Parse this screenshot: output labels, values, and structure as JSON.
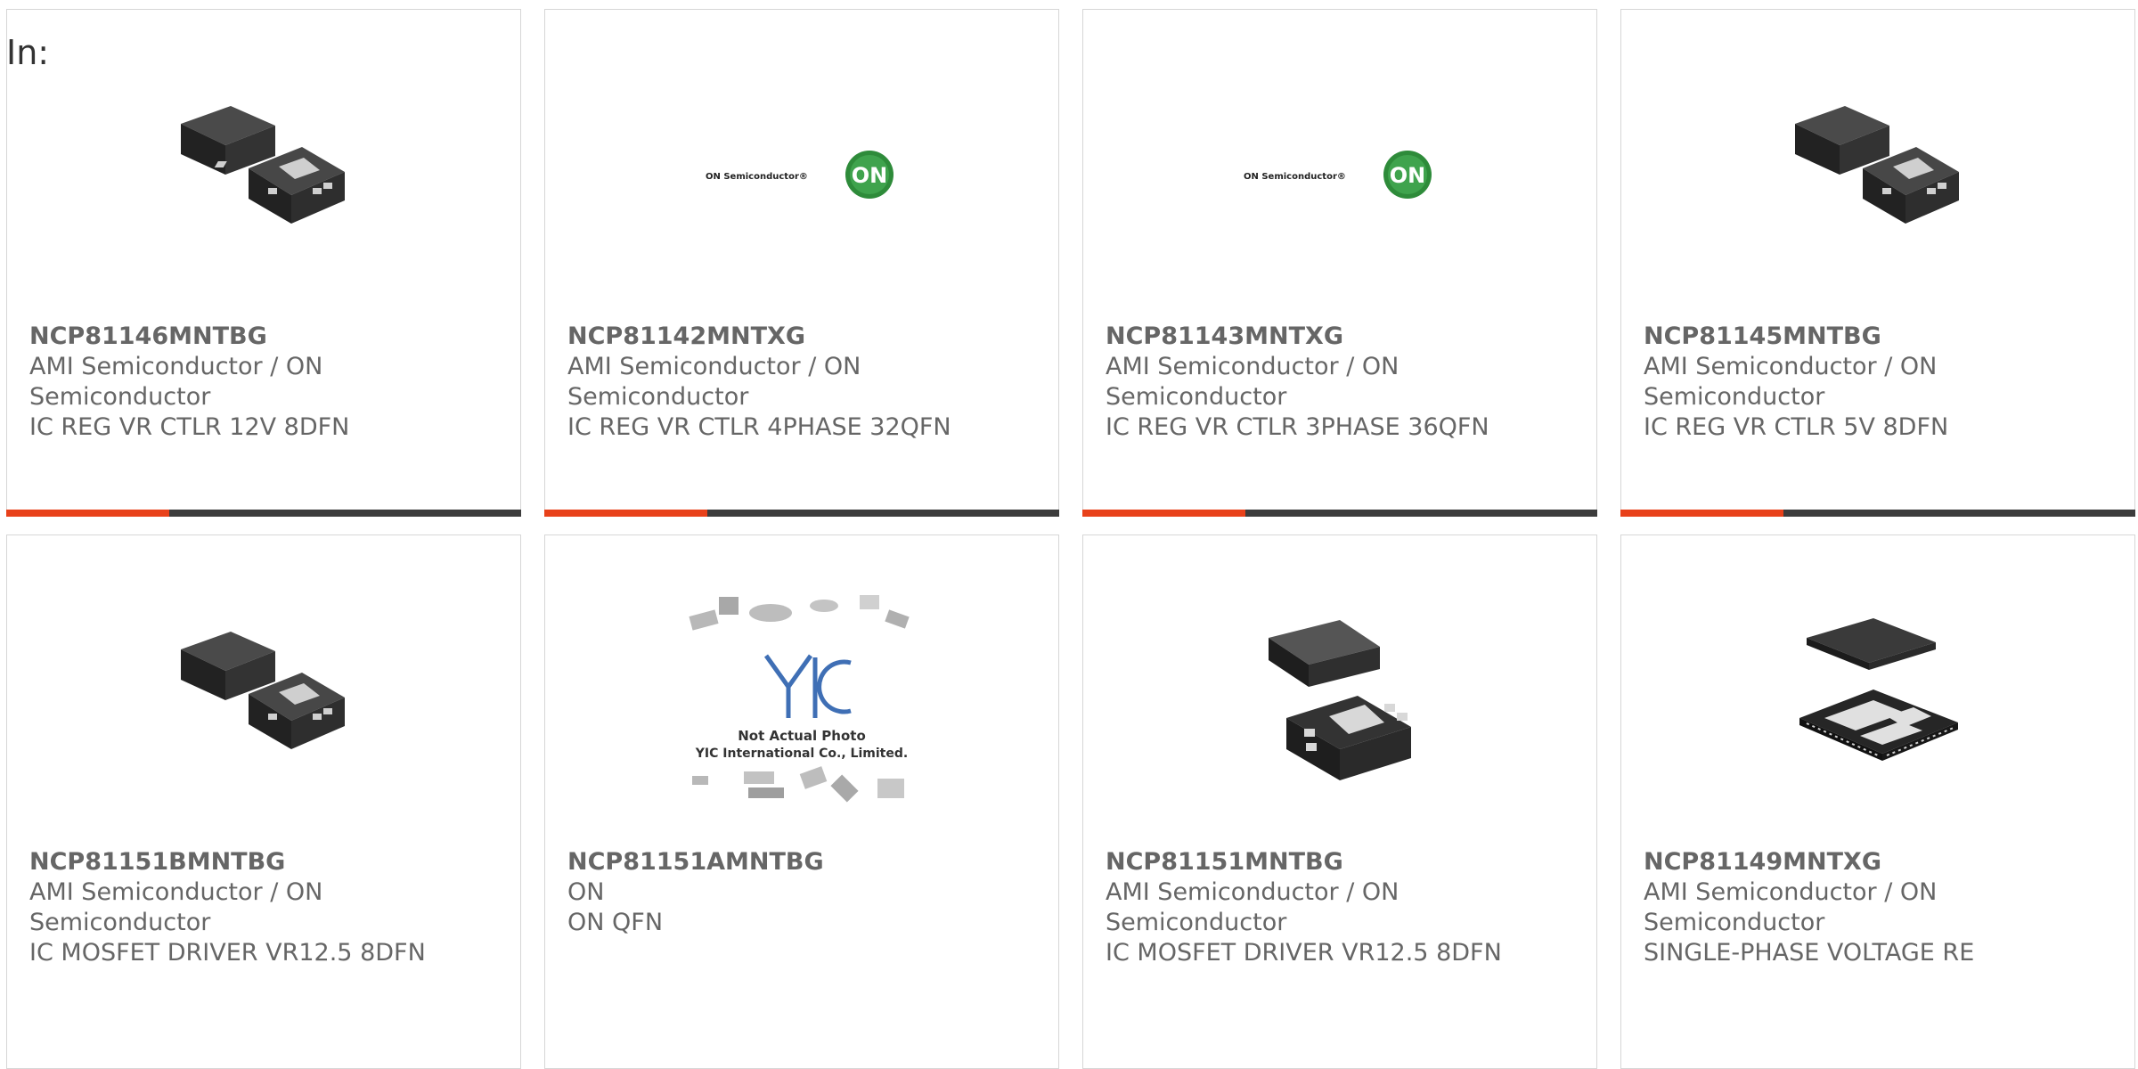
{
  "filter_label": "In:",
  "colors": {
    "accent": "#e8411a",
    "bar_dark": "#3c3c3c",
    "text": "#666666",
    "border": "#d6d6d6"
  },
  "products": [
    {
      "part": "NCP81146MNTBG",
      "manufacturer": "AMI Semiconductor / ON Semiconductor",
      "description": "IC REG VR CTLR 12V 8DFN",
      "image": "dfn-package-photo"
    },
    {
      "part": "NCP81142MNTXG",
      "manufacturer": "AMI Semiconductor / ON Semiconductor",
      "description": "IC REG VR CTLR 4PHASE 32QFN",
      "image": "on-semiconductor-logo",
      "logo_text": "ON Semiconductor®",
      "logo_mark": "ON"
    },
    {
      "part": "NCP81143MNTXG",
      "manufacturer": "AMI Semiconductor / ON Semiconductor",
      "description": "IC REG VR CTLR 3PHASE 36QFN",
      "image": "on-semiconductor-logo",
      "logo_text": "ON Semiconductor®",
      "logo_mark": "ON"
    },
    {
      "part": "NCP81145MNTBG",
      "manufacturer": "AMI Semiconductor / ON Semiconductor",
      "description": "IC REG VR CTLR 5V 8DFN",
      "image": "dfn-package-photo"
    },
    {
      "part": "NCP81151BMNTBG",
      "manufacturer": "AMI Semiconductor / ON Semiconductor",
      "description": "IC MOSFET DRIVER VR12.5 8DFN",
      "image": "dfn-package-photo"
    },
    {
      "part": "NCP81151AMNTBG",
      "manufacturer": "ON",
      "description": "ON QFN",
      "image": "yic-placeholder",
      "logo_mark": "YIC",
      "placeholder_line1": "Not Actual Photo",
      "placeholder_line2": "YIC International Co., Limited."
    },
    {
      "part": "NCP81151MNTBG",
      "manufacturer": "AMI Semiconductor / ON Semiconductor",
      "description": "IC MOSFET DRIVER VR12.5 8DFN",
      "image": "dfn-package-photo-large"
    },
    {
      "part": "NCP81149MNTXG",
      "manufacturer": "AMI Semiconductor / ON Semiconductor",
      "description": "SINGLE-PHASE VOLTAGE RE",
      "image": "qfn-package-photo"
    }
  ]
}
